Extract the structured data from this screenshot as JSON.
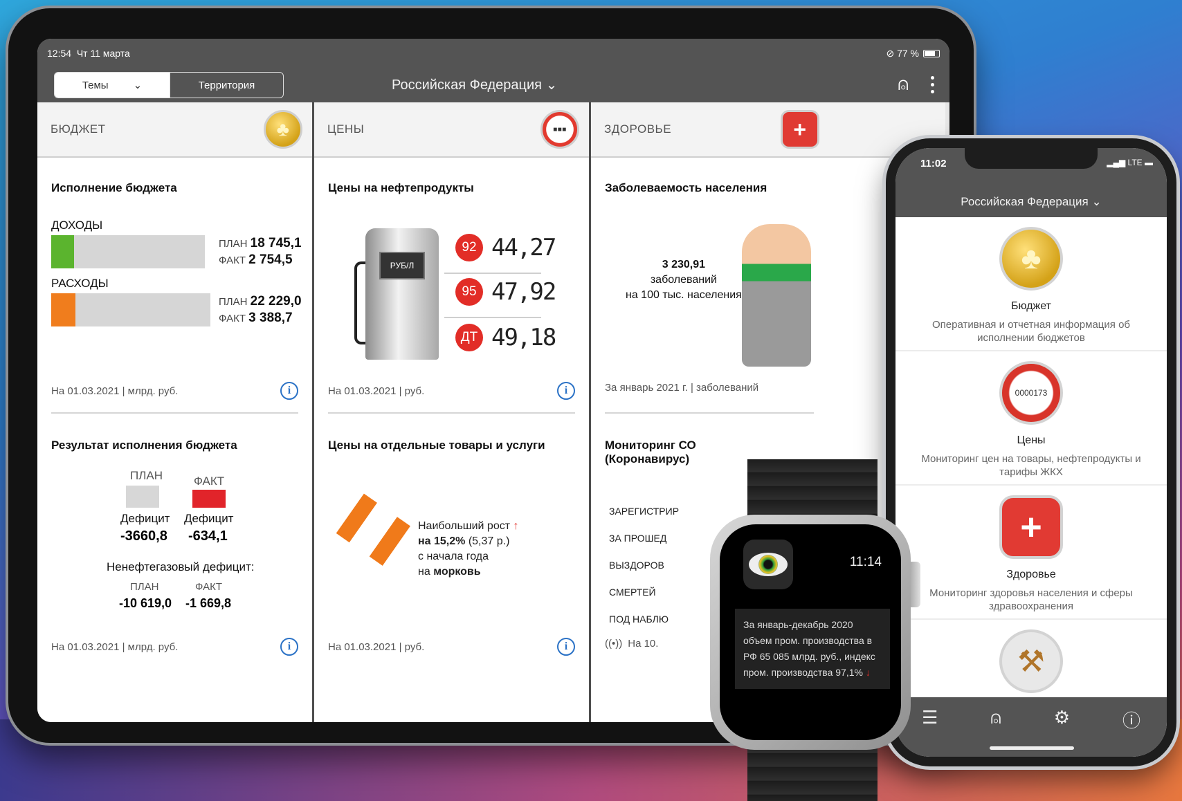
{
  "tablet": {
    "status": {
      "time": "12:54",
      "date": "Чт 11 марта",
      "battery": "77 %"
    },
    "nav": {
      "segment_topics": "Темы",
      "segment_territory": "Территория",
      "region": "Российская Федерация"
    },
    "budget": {
      "header": "БЮДЖЕТ",
      "card1": {
        "title": "Исполнение бюджета",
        "income": {
          "label": "ДОХОДЫ",
          "plan_label": "ПЛАН",
          "plan": "18 745,1",
          "fact_label": "ФАКТ",
          "fact": "2 754,5",
          "fraction": 0.147,
          "color": "#5bb42e"
        },
        "expense": {
          "label": "РАСХОДЫ",
          "plan_label": "ПЛАН",
          "plan": "22 229,0",
          "fact_label": "ФАКТ",
          "fact": "3 388,7",
          "fraction": 0.152,
          "color": "#f07d1d"
        },
        "footer": "На 01.03.2021 | млрд. руб."
      },
      "card2": {
        "title": "Результат исполнения бюджета",
        "plan_label": "ПЛАН",
        "fact_label": "ФАКТ",
        "deficit_label": "Дефицит",
        "plan_value": "-3660,8",
        "fact_value": "-634,1",
        "nonoil_label": "Ненефтегазовый дефицит:",
        "nonoil_plan_label": "ПЛАН",
        "nonoil_fact_label": "ФАКТ",
        "nonoil_plan": "-10 619,0",
        "nonoil_fact": "-1 669,8",
        "footer": "На 01.03.2021 | млрд. руб."
      }
    },
    "prices": {
      "header": "ЦЕНЫ",
      "card1": {
        "title": "Цены на нефтепродукты",
        "pump_label": "РУБ/Л",
        "items": [
          {
            "grade": "92",
            "price": "44,27"
          },
          {
            "grade": "95",
            "price": "47,92"
          },
          {
            "grade": "ДТ",
            "price": "49,18"
          }
        ],
        "footer": "На 01.03.2021 | руб."
      },
      "card2": {
        "title": "Цены на отдельные товары и услуги",
        "line1": "Наибольший рост",
        "line2a": "на 15,2%",
        "line2b": " (5,37 р.)",
        "line3": "с начала года",
        "line4a": "на ",
        "line4b": "морковь",
        "footer": "На 01.03.2021 | руб."
      }
    },
    "health": {
      "header": "ЗДОРОВЬЕ",
      "card1": {
        "title": "Заболеваемость населения",
        "value": "3 230,91",
        "unit1": "заболеваний",
        "unit2": "на 100 тыс. населения",
        "footer": "За январь 2021 г. | заболеваний"
      },
      "card2": {
        "title": "Мониторинг СО",
        "title2": "(Коронавирус)",
        "rows": [
          "ЗАРЕГИСТРИР",
          "ЗА ПРОШЕД",
          "ВЫЗДОРОВ",
          "СМЕРТЕЙ",
          "ПОД НАБЛЮ"
        ],
        "footer": "На 10."
      }
    }
  },
  "phone": {
    "time": "11:02",
    "signal": "LTE",
    "region": "Российская Федерация",
    "items": [
      {
        "name": "Бюджет",
        "desc": "Оперативная и отчетная информация об исполнении бюджетов"
      },
      {
        "name": "Цены",
        "desc": "Мониторинг цен на товары, нефтепродукты и тарифы ЖКХ"
      },
      {
        "name": "Здоровье",
        "desc": "Мониторинг здоровья населения и сферы здравоохранения"
      }
    ],
    "meter_text": "0000173"
  },
  "watch": {
    "time": "11:14",
    "message": "За январь-декабрь 2020 объем пром. производства в РФ 65 085 млрд. руб., индекс пром. производства 97,1%"
  }
}
